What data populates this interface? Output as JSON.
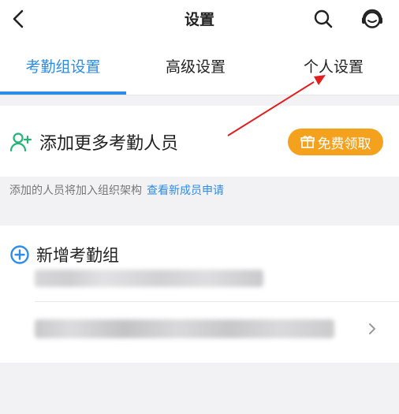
{
  "header": {
    "title": "设置",
    "back_icon": "chevron-left-icon",
    "search_icon": "search-icon",
    "service_icon": "customer-service-icon"
  },
  "tabs": [
    {
      "label": "考勤组设置",
      "active": true
    },
    {
      "label": "高级设置",
      "active": false
    },
    {
      "label": "个人设置",
      "active": false
    }
  ],
  "add_members": {
    "label": "添加更多考勤人员",
    "icon": "add-user-icon",
    "button_label": "免费领取",
    "button_icon": "gift-icon"
  },
  "hint": {
    "text": "添加的人员将加入组织架构",
    "link": "查看新成员申请"
  },
  "groups": {
    "new_label": "新增考勤组",
    "new_icon": "plus-circle-icon"
  },
  "colors": {
    "accent": "#2d8ce6",
    "button": "#f4a21d",
    "annotation": "#e02020"
  }
}
